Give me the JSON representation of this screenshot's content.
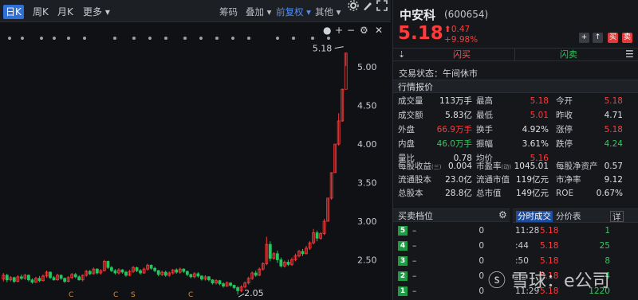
{
  "toolbar": {
    "tabs": [
      "日K",
      "周K",
      "月K",
      "更多"
    ],
    "tools": [
      "筹码",
      "叠加",
      "前复权",
      "其他"
    ]
  },
  "chart_data": {
    "type": "candlestick",
    "y_ticks": [
      "5.00",
      "4.50",
      "4.00",
      "3.50",
      "3.00",
      "2.50"
    ],
    "ylim": [
      2.0,
      5.3
    ],
    "high_label": "5.18",
    "low_label": "2.05",
    "event_markers": [
      "C",
      "C",
      "S",
      "C"
    ],
    "candles": [
      [
        2.25,
        2.3,
        2.22,
        2.33
      ],
      [
        2.3,
        2.24,
        2.21,
        2.32
      ],
      [
        2.24,
        2.27,
        2.22,
        2.29
      ],
      [
        2.27,
        2.22,
        2.2,
        2.28
      ],
      [
        2.22,
        2.28,
        2.21,
        2.3
      ],
      [
        2.28,
        2.26,
        2.24,
        2.31
      ],
      [
        2.26,
        2.3,
        2.24,
        2.32
      ],
      [
        2.3,
        2.24,
        2.22,
        2.31
      ],
      [
        2.24,
        2.21,
        2.19,
        2.26
      ],
      [
        2.21,
        2.26,
        2.2,
        2.28
      ],
      [
        2.26,
        2.23,
        2.21,
        2.29
      ],
      [
        2.23,
        2.29,
        2.22,
        2.31
      ],
      [
        2.29,
        2.34,
        2.27,
        2.36
      ],
      [
        2.34,
        2.27,
        2.25,
        2.35
      ],
      [
        2.27,
        2.24,
        2.23,
        2.29
      ],
      [
        2.24,
        2.3,
        2.23,
        2.32
      ],
      [
        2.3,
        2.26,
        2.24,
        2.31
      ],
      [
        2.26,
        2.22,
        2.2,
        2.27
      ],
      [
        2.22,
        2.27,
        2.21,
        2.29
      ],
      [
        2.27,
        2.31,
        2.25,
        2.33
      ],
      [
        2.31,
        2.28,
        2.26,
        2.33
      ],
      [
        2.28,
        2.24,
        2.23,
        2.3
      ],
      [
        2.24,
        2.3,
        2.22,
        2.31
      ],
      [
        2.3,
        2.35,
        2.28,
        2.37
      ],
      [
        2.35,
        2.32,
        2.3,
        2.37
      ],
      [
        2.32,
        2.38,
        2.31,
        2.4
      ],
      [
        2.38,
        2.33,
        2.31,
        2.39
      ],
      [
        2.33,
        2.36,
        2.31,
        2.38
      ],
      [
        2.36,
        2.48,
        2.35,
        2.5
      ],
      [
        2.48,
        2.4,
        2.38,
        2.49
      ],
      [
        2.4,
        2.36,
        2.34,
        2.42
      ],
      [
        2.36,
        2.33,
        2.31,
        2.38
      ],
      [
        2.33,
        2.37,
        2.31,
        2.39
      ],
      [
        2.37,
        2.34,
        2.32,
        2.38
      ],
      [
        2.34,
        2.3,
        2.28,
        2.36
      ],
      [
        2.3,
        2.35,
        2.29,
        2.37
      ],
      [
        2.35,
        2.4,
        2.33,
        2.42
      ],
      [
        2.4,
        2.36,
        2.34,
        2.41
      ],
      [
        2.36,
        2.33,
        2.31,
        2.38
      ],
      [
        2.33,
        2.38,
        2.32,
        2.4
      ],
      [
        2.38,
        2.43,
        2.36,
        2.45
      ],
      [
        2.43,
        2.39,
        2.37,
        2.44
      ],
      [
        2.39,
        2.36,
        2.34,
        2.41
      ],
      [
        2.36,
        2.31,
        2.29,
        2.37
      ],
      [
        2.31,
        2.34,
        2.29,
        2.36
      ],
      [
        2.34,
        2.3,
        2.28,
        2.36
      ],
      [
        2.3,
        2.33,
        2.28,
        2.35
      ],
      [
        2.33,
        2.37,
        2.31,
        2.38
      ],
      [
        2.37,
        2.34,
        2.32,
        2.39
      ],
      [
        2.34,
        2.38,
        2.32,
        2.4
      ],
      [
        2.38,
        2.35,
        2.33,
        2.39
      ],
      [
        2.35,
        2.31,
        2.29,
        2.36
      ],
      [
        2.31,
        2.28,
        2.26,
        2.32
      ],
      [
        2.28,
        2.32,
        2.26,
        2.34
      ],
      [
        2.32,
        2.29,
        2.27,
        2.34
      ],
      [
        2.29,
        2.25,
        2.23,
        2.3
      ],
      [
        2.25,
        2.28,
        2.23,
        2.3
      ],
      [
        2.28,
        2.24,
        2.22,
        2.29
      ],
      [
        2.24,
        2.2,
        2.18,
        2.25
      ],
      [
        2.2,
        2.23,
        2.18,
        2.25
      ],
      [
        2.23,
        2.19,
        2.17,
        2.24
      ],
      [
        2.19,
        2.16,
        2.14,
        2.21
      ],
      [
        2.16,
        2.2,
        2.15,
        2.22
      ],
      [
        2.2,
        2.17,
        2.15,
        2.21
      ],
      [
        2.17,
        2.14,
        2.12,
        2.18
      ],
      [
        2.14,
        2.1,
        2.05,
        2.16
      ],
      [
        2.1,
        2.15,
        2.08,
        2.17
      ],
      [
        2.15,
        2.2,
        2.13,
        2.22
      ],
      [
        2.2,
        2.26,
        2.18,
        2.28
      ],
      [
        2.26,
        2.33,
        2.24,
        2.35
      ],
      [
        2.33,
        2.3,
        2.28,
        2.36
      ],
      [
        2.3,
        2.38,
        2.29,
        2.4
      ],
      [
        2.38,
        2.45,
        2.36,
        2.47
      ],
      [
        2.45,
        2.7,
        2.43,
        2.8
      ],
      [
        2.7,
        2.52,
        2.48,
        2.74
      ],
      [
        2.52,
        2.58,
        2.5,
        2.6
      ],
      [
        2.58,
        2.5,
        2.46,
        2.62
      ],
      [
        2.5,
        2.42,
        2.4,
        2.53
      ],
      [
        2.42,
        2.47,
        2.4,
        2.49
      ],
      [
        2.47,
        2.44,
        2.42,
        2.5
      ],
      [
        2.44,
        2.5,
        2.42,
        2.53
      ],
      [
        2.5,
        2.55,
        2.48,
        2.58
      ],
      [
        2.55,
        2.61,
        2.53,
        2.63
      ],
      [
        2.61,
        2.58,
        2.55,
        2.64
      ],
      [
        2.58,
        2.65,
        2.57,
        2.68
      ],
      [
        2.65,
        2.72,
        2.63,
        2.74
      ],
      [
        2.72,
        2.85,
        2.7,
        2.9
      ],
      [
        2.85,
        2.78,
        2.74,
        2.88
      ],
      [
        2.78,
        2.84,
        2.76,
        2.86
      ],
      [
        2.84,
        3.0,
        2.82,
        3.03
      ],
      [
        3.0,
        3.3,
        3.0,
        3.3
      ],
      [
        3.3,
        3.63,
        3.28,
        3.63
      ],
      [
        3.63,
        4.0,
        3.63,
        4.0
      ],
      [
        4.0,
        4.3,
        3.98,
        4.4
      ],
      [
        4.3,
        4.71,
        4.29,
        4.72
      ],
      [
        4.71,
        5.18,
        5.01,
        5.18
      ]
    ]
  },
  "stock": {
    "name": "中安科",
    "code": "(600654)",
    "price": "5.18",
    "change": "0.47",
    "change_pct": "+9.98%",
    "buttons": [
      "+",
      "↑",
      "买",
      "卖"
    ]
  },
  "trade": {
    "buy": "闪买",
    "sell": "闪卖"
  },
  "status": "交易状态：午间休市",
  "quote_title": "行情报价",
  "quote": [
    [
      {
        "l": "成交量",
        "v": "113万手",
        "c": "wht"
      },
      {
        "l": "最高",
        "v": "5.18",
        "c": "red"
      },
      {
        "l": "今开",
        "v": "5.18",
        "c": "red"
      }
    ],
    [
      {
        "l": "成交额",
        "v": "5.83亿",
        "c": "wht"
      },
      {
        "l": "最低",
        "v": "5.01",
        "c": "red"
      },
      {
        "l": "昨收",
        "v": "4.71",
        "c": "wht"
      }
    ],
    [
      {
        "l": "外盘",
        "v": "66.9万手",
        "c": "red"
      },
      {
        "l": "换手",
        "v": "4.92%",
        "c": "wht"
      },
      {
        "l": "涨停",
        "v": "5.18",
        "c": "red"
      }
    ],
    [
      {
        "l": "内盘",
        "v": "46.0万手",
        "c": "green"
      },
      {
        "l": "振幅",
        "v": "3.61%",
        "c": "wht"
      },
      {
        "l": "跌停",
        "v": "4.24",
        "c": "green"
      }
    ],
    [
      {
        "l": "量比",
        "v": "0.78",
        "c": "wht"
      },
      {
        "l": "均价",
        "v": "5.16",
        "c": "red"
      },
      {
        "l": "",
        "v": "",
        "c": "wht"
      }
    ]
  ],
  "fundamentals": [
    [
      {
        "l": "每股收益",
        "sup": "(三)",
        "v": "0.004"
      },
      {
        "l": "市盈率",
        "sup": "(动)",
        "v": "1045.01"
      },
      {
        "l": "每股净资产",
        "v": "0.57"
      }
    ],
    [
      {
        "l": "流通股本",
        "v": "23.0亿"
      },
      {
        "l": "流通市值",
        "v": "119亿元"
      },
      {
        "l": "市净率",
        "v": "9.12"
      }
    ],
    [
      {
        "l": "总股本",
        "v": "28.8亿"
      },
      {
        "l": "总市值",
        "v": "149亿元"
      },
      {
        "l": "ROE",
        "v": "0.67%"
      }
    ]
  ],
  "orderbook_title": "买卖档位",
  "orderbook": [
    {
      "n": "5",
      "p": "–",
      "v": "0"
    },
    {
      "n": "4",
      "p": "–",
      "v": "0"
    },
    {
      "n": "3",
      "p": "–",
      "v": "0"
    },
    {
      "n": "2",
      "p": "–",
      "v": "0"
    },
    {
      "n": "1",
      "p": "–",
      "v": "0"
    }
  ],
  "ticks_tabs": [
    "分时成交",
    "分价表",
    "详"
  ],
  "ticks": [
    {
      "t": "11:28",
      "p": "5.18",
      "v": "1"
    },
    {
      "t": ":44",
      "p": "5.18",
      "v": "25"
    },
    {
      "t": ":50",
      "p": "5.18",
      "v": "8"
    },
    {
      "t": "",
      "p": "5.18",
      "v": "4"
    },
    {
      "t": "11:29",
      "p": "5.18",
      "v": "1220"
    }
  ],
  "watermark": "雪球：e公司"
}
